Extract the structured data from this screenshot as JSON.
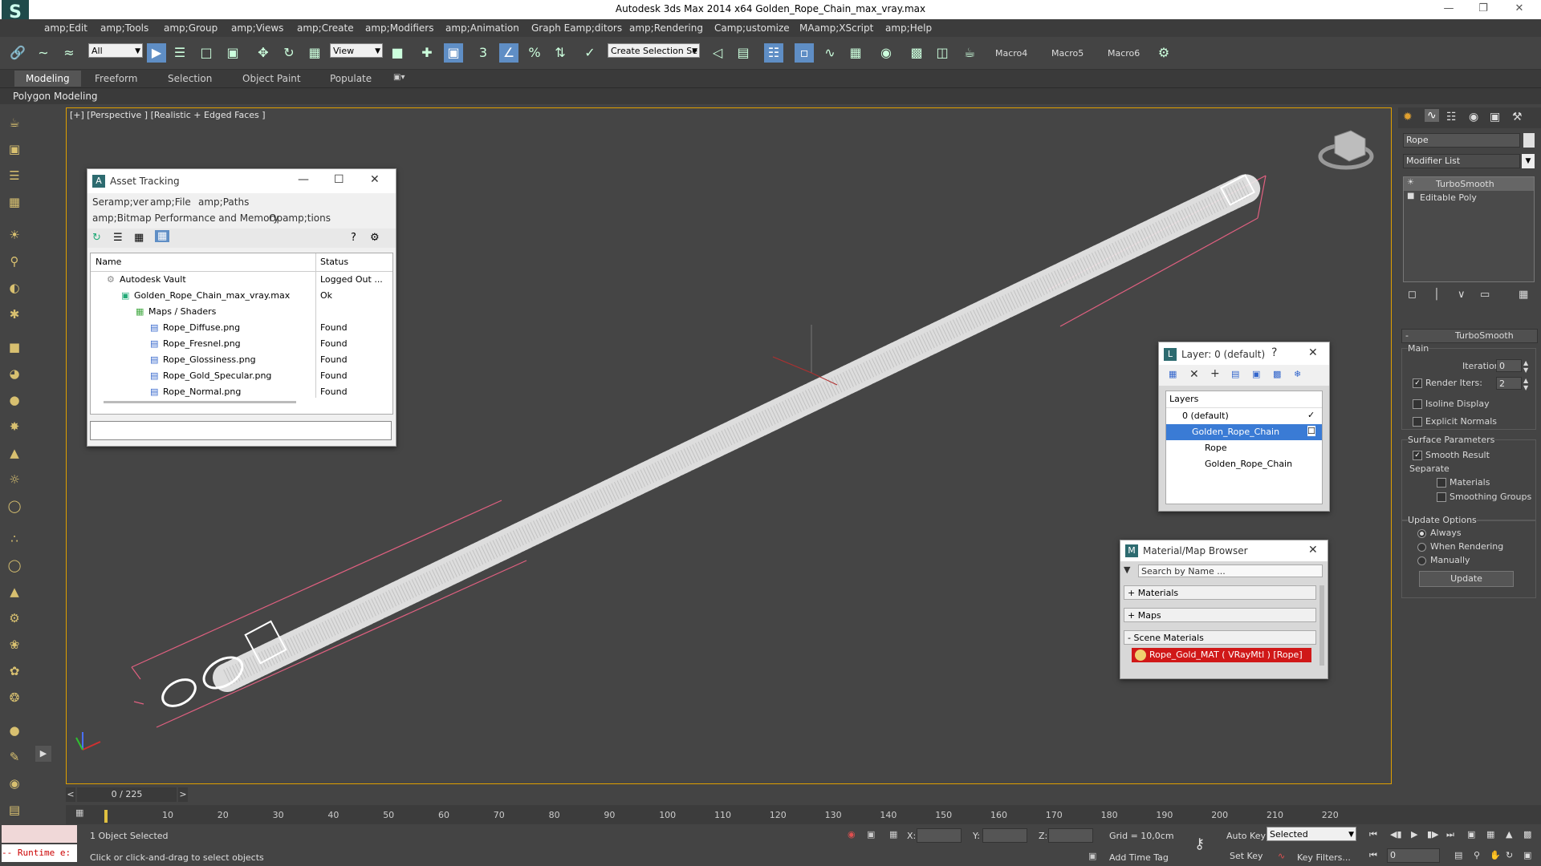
{
  "window": {
    "title": "Autodesk 3ds Max  2014 x64     Golden_Rope_Chain_max_vray.max"
  },
  "menu": [
    "amp;Edit",
    "amp;Tools",
    "amp;Group",
    "amp;Views",
    "amp;Create",
    "amp;Modifiers",
    "amp;Animation",
    "Graph Eamp;ditors",
    "amp;Rendering",
    "Camp;ustomize",
    "MAamp;XScript",
    "amp;Help"
  ],
  "toolbar": {
    "filter_combo": "All",
    "view_combo": "View",
    "selection_set_combo": "Create Selection Se",
    "macros": [
      "Macro4",
      "Macro5",
      "Macro6"
    ]
  },
  "ribbon": {
    "tabs": [
      "Modeling",
      "Freeform",
      "Selection",
      "Object Paint",
      "Populate"
    ],
    "active_tab": "Modeling",
    "sub": "Polygon Modeling"
  },
  "viewport": {
    "label": "[+] [Perspective ] [Realistic + Edged Faces ]"
  },
  "asset_tracking": {
    "title": "Asset Tracking",
    "menus": [
      "Seramp;ver",
      "amp;File",
      "amp;Paths",
      "amp;Bitmap Performance and Memory",
      "Opamp;tions"
    ],
    "columns": [
      "Name",
      "Status"
    ],
    "rows": [
      {
        "name": "Autodesk Vault",
        "status": "Logged Out ..."
      },
      {
        "name": "Golden_Rope_Chain_max_vray.max",
        "status": "Ok"
      },
      {
        "name": "Maps / Shaders",
        "status": ""
      },
      {
        "name": "Rope_Diffuse.png",
        "status": "Found"
      },
      {
        "name": "Rope_Fresnel.png",
        "status": "Found"
      },
      {
        "name": "Rope_Glossiness.png",
        "status": "Found"
      },
      {
        "name": "Rope_Gold_Specular.png",
        "status": "Found"
      },
      {
        "name": "Rope_Normal.png",
        "status": "Found"
      }
    ]
  },
  "layer_dialog": {
    "title": "Layer: 0 (default)",
    "help": "?",
    "header": "Layers",
    "items": [
      "0 (default)",
      "Golden_Rope_Chain",
      "Rope",
      "Golden_Rope_Chain"
    ]
  },
  "material_browser": {
    "title": "Material/Map Browser",
    "search_placeholder": "Search by Name ...",
    "groups": [
      "+ Materials",
      "+ Maps",
      "- Scene Materials"
    ],
    "scene_material": "Rope_Gold_MAT ( VRayMtl ) [Rope]"
  },
  "command_panel": {
    "object_name": "Rope",
    "modifier_list": "Modifier List",
    "stack": [
      "TurboSmooth",
      "Editable Poly"
    ],
    "rollout_title": "TurboSmooth",
    "main_label": "Main",
    "iterations_label": "Iterations:",
    "iterations_value": "0",
    "render_iters_label": "Render Iters:",
    "render_iters_value": "2",
    "isoline_display": "Isoline Display",
    "explicit_normals": "Explicit Normals",
    "surface_params": "Surface Parameters",
    "smooth_result": "Smooth Result",
    "separate": "Separate",
    "materials": "Materials",
    "smoothing_groups": "Smoothing Groups",
    "update_options": "Update Options",
    "always": "Always",
    "when_rendering": "When Rendering",
    "manually": "Manually",
    "update_button": "Update"
  },
  "timeline": {
    "frame": "0 / 225",
    "ticks": [
      "10",
      "20",
      "30",
      "40",
      "50",
      "60",
      "70",
      "80",
      "90",
      "100",
      "110",
      "120",
      "130",
      "140",
      "150",
      "160",
      "170",
      "180",
      "190",
      "200",
      "210",
      "220"
    ]
  },
  "status": {
    "runtime": "-- Runtime e:",
    "selected": "1 Object Selected",
    "prompt": "Click or click-and-drag to select objects",
    "x_label": "X:",
    "y_label": "Y:",
    "z_label": "Z:",
    "grid": "Grid = 10,0cm",
    "add_time_tag": "Add Time Tag",
    "auto_key": "Auto Key",
    "set_key": "Set Key",
    "key_mode": "Selected",
    "key_filters": "Key Filters...",
    "frame_field": "0"
  }
}
